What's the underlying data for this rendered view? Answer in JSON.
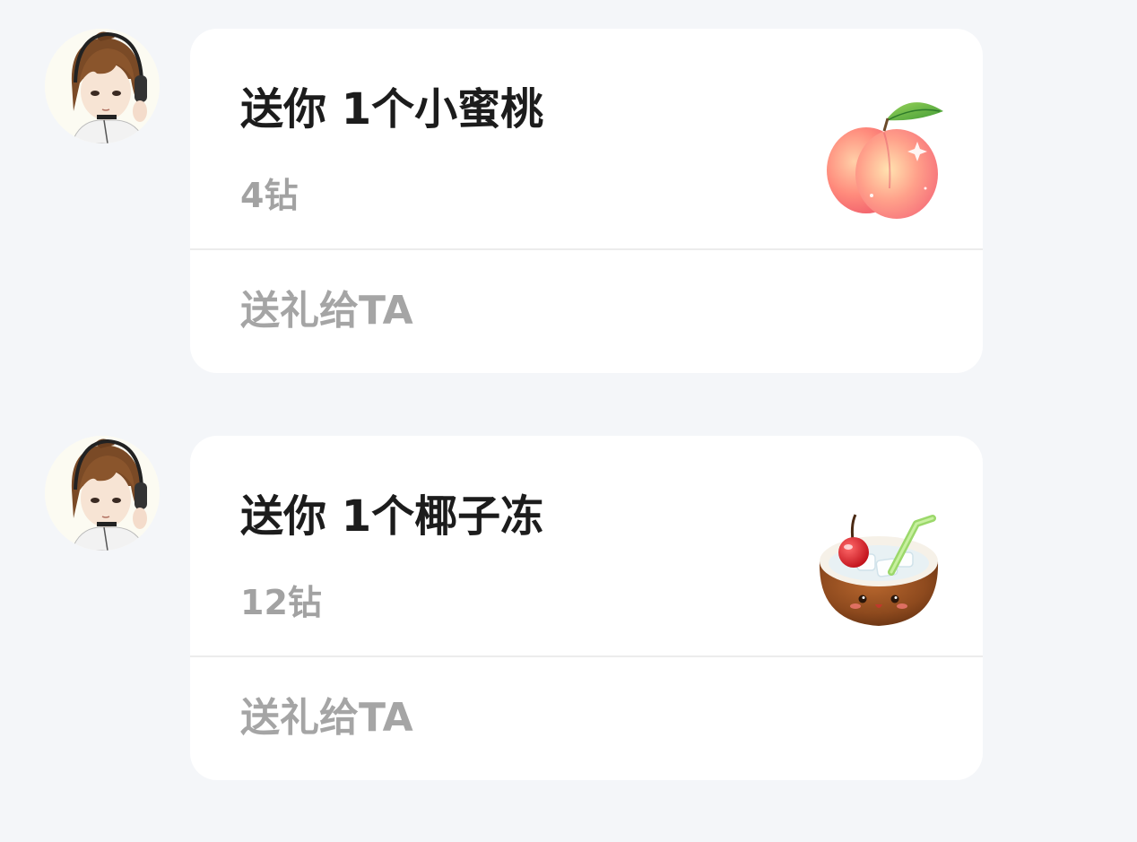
{
  "messages": [
    {
      "gift_title": "送你 1个小蜜桃",
      "gift_price": "4钻",
      "gift_icon": "peach-icon",
      "send_label": "送礼给TA"
    },
    {
      "gift_title": "送你 1个椰子冻",
      "gift_price": "12钻",
      "gift_icon": "coconut-jelly-icon",
      "send_label": "送礼给TA"
    }
  ]
}
